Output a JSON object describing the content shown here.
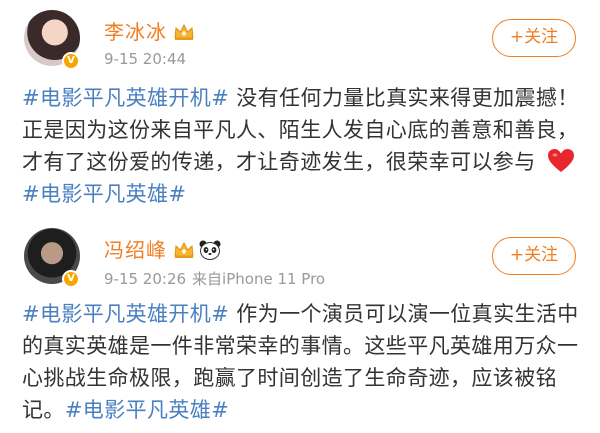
{
  "posts": [
    {
      "user_name": "李冰冰",
      "timestamp": "9-15 20:44",
      "follow_label": "+关注",
      "text_parts": [
        {
          "type": "tag",
          "text": "#电影平凡英雄开机#"
        },
        {
          "type": "text",
          "text": " 没有任何力量比真实来得更加震撼！正是因为这份来自平凡人、陌生人发自心底的善意和善良，才有了这份爱的传递，才让奇迹发生，很荣幸可以参与 "
        },
        {
          "type": "emoji",
          "name": "heart-emoji"
        },
        {
          "type": "tag",
          "text": "#电影平凡英雄#"
        }
      ]
    },
    {
      "user_name": "冯绍峰",
      "timestamp": "9-15 20:26",
      "source": "来自iPhone 11 Pro",
      "follow_label": "+关注",
      "text_parts": [
        {
          "type": "tag",
          "text": "#电影平凡英雄开机#"
        },
        {
          "type": "text",
          "text": " 作为一个演员可以演一位真实生活中的真实英雄是一件非常荣幸的事情。这些平凡英雄用万众一心挑战生命极限，跑赢了时间创造了生命奇迹，应该被铭记。"
        },
        {
          "type": "tag",
          "text": "#电影平凡英雄#"
        }
      ]
    }
  ],
  "icons": {
    "verified": "verified-badge-icon",
    "crown": "crown-icon",
    "panda": "panda-icon",
    "heart": "heart-emoji"
  },
  "colors": {
    "name": "#f07e22",
    "tag": "#4a7fc1",
    "meta": "#999999",
    "verified": "#f7a600"
  }
}
